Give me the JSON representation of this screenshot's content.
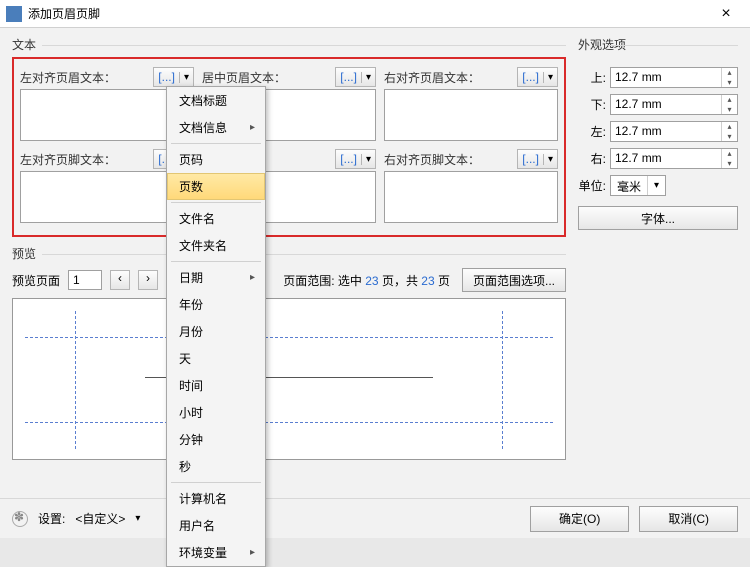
{
  "title": "添加页眉页脚",
  "text_group": "文本",
  "appearance_group": "外观选项",
  "fields": {
    "left_header": "左对齐页眉文本：",
    "center_header": "居中页眉文本：",
    "right_header": "右对齐页眉文本：",
    "left_footer": "左对齐页脚文本：",
    "right_footer": "右对齐页脚文本："
  },
  "marker": "[...]",
  "margins": {
    "top_lbl": "上:",
    "top_val": "12.7 mm",
    "bottom_lbl": "下:",
    "bottom_val": "12.7 mm",
    "left_lbl": "左:",
    "left_val": "12.7 mm",
    "right_lbl": "右:",
    "right_val": "12.7 mm"
  },
  "unit_lbl": "单位:",
  "unit_val": "毫米",
  "font_btn": "字体...",
  "preview_lbl": "预览",
  "preview_page_lbl": "预览页面",
  "preview_page_val": "1",
  "page_range_prefix": "页面范围: 选中 ",
  "page_range_count": "23",
  "page_range_mid": " 页，共 ",
  "page_range_total": "23",
  "page_range_suffix": " 页",
  "page_range_btn": "页面范围选项...",
  "settings_lbl": "设置:",
  "settings_val": "<自定义>",
  "ok_btn": "确定(O)",
  "cancel_btn": "取消(C)",
  "menu": {
    "doc_title": "文档标题",
    "doc_info": "文档信息",
    "page_num": "页码",
    "page_count": "页数",
    "file_name": "文件名",
    "folder_name": "文件夹名",
    "date": "日期",
    "year": "年份",
    "month": "月份",
    "day": "天",
    "time": "时间",
    "hour": "小时",
    "minute": "分钟",
    "second": "秒",
    "computer": "计算机名",
    "user": "用户名",
    "env": "环境变量"
  }
}
